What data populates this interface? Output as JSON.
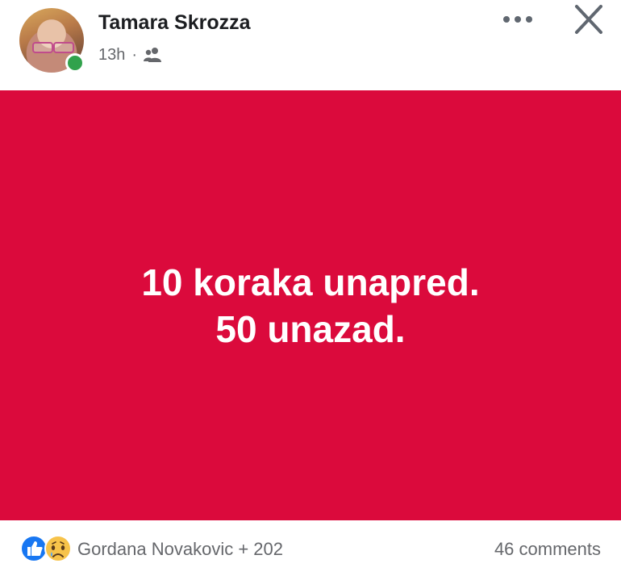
{
  "post": {
    "author": "Tamara Skrozza",
    "time": "13h",
    "separator": "·",
    "audience_icon": "friends-icon",
    "image_text": {
      "line1": "10 koraka unapred.",
      "line2": "50 unazad."
    },
    "background_color": "#db0a3c"
  },
  "reactions": {
    "icons": [
      "like-icon",
      "sad-icon"
    ],
    "summary": "Gordana Novakovic + 202",
    "comments": "46 comments"
  },
  "colors": {
    "online": "#31a24c",
    "like": "#1877f2",
    "secondary_text": "#65676b"
  }
}
